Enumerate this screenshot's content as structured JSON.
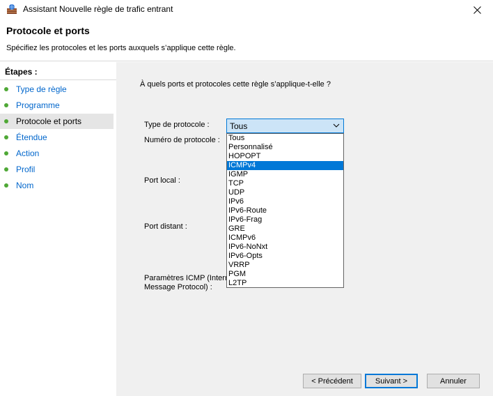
{
  "window": {
    "title": "Assistant Nouvelle règle de trafic entrant"
  },
  "header": {
    "title": "Protocole et ports",
    "description": "Spécifiez les protocoles et les ports auxquels s’applique cette règle."
  },
  "sidebar": {
    "title": "Étapes :",
    "steps": [
      {
        "label": "Type de règle",
        "active": false
      },
      {
        "label": "Programme",
        "active": false
      },
      {
        "label": "Protocole et ports",
        "active": true
      },
      {
        "label": "Étendue",
        "active": false
      },
      {
        "label": "Action",
        "active": false
      },
      {
        "label": "Profil",
        "active": false
      },
      {
        "label": "Nom",
        "active": false
      }
    ]
  },
  "main": {
    "question": "À quels ports et protocoles cette règle s’applique-t-elle ?",
    "protocol_type_label": "Type de protocole :",
    "protocol_number_label": "Numéro de protocole :",
    "local_port_label": "Port local :",
    "remote_port_label": "Port distant :",
    "icmp_label_line1": "Paramètres ICMP (Interne",
    "icmp_label_line2": "Message Protocol) :",
    "protocol_combo": {
      "value": "Tous",
      "options": [
        "Tous",
        "Personnalisé",
        "HOPOPT",
        "ICMPv4",
        "IGMP",
        "TCP",
        "UDP",
        "IPv6",
        "IPv6-Route",
        "IPv6-Frag",
        "GRE",
        "ICMPv6",
        "IPv6-NoNxt",
        "IPv6-Opts",
        "VRRP",
        "PGM",
        "L2TP"
      ],
      "highlighted": "ICMPv4"
    }
  },
  "buttons": {
    "back": "< Précédent",
    "next": "Suivant >",
    "cancel": "Annuler"
  },
  "colors": {
    "accent": "#0078d7",
    "step_dot": "#4fa836",
    "link": "#0066cc"
  }
}
